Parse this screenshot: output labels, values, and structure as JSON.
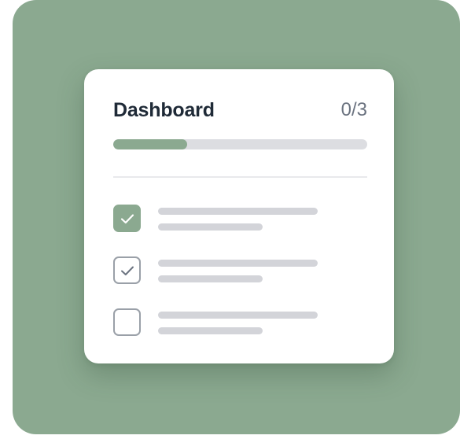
{
  "app": {
    "background_color": "#ffffff",
    "tile_color": "#8ba990",
    "accent_color": "#8ba990",
    "placeholder_color": "#d3d4d9"
  },
  "card": {
    "title": "Dashboard",
    "progress_label": "0/3",
    "progress_fraction": 0.29
  },
  "tasks": [
    {
      "state": "checked-filled",
      "icon": "checkmark-icon"
    },
    {
      "state": "checked-outline",
      "icon": "checkmark-icon"
    },
    {
      "state": "unchecked",
      "icon": ""
    }
  ]
}
